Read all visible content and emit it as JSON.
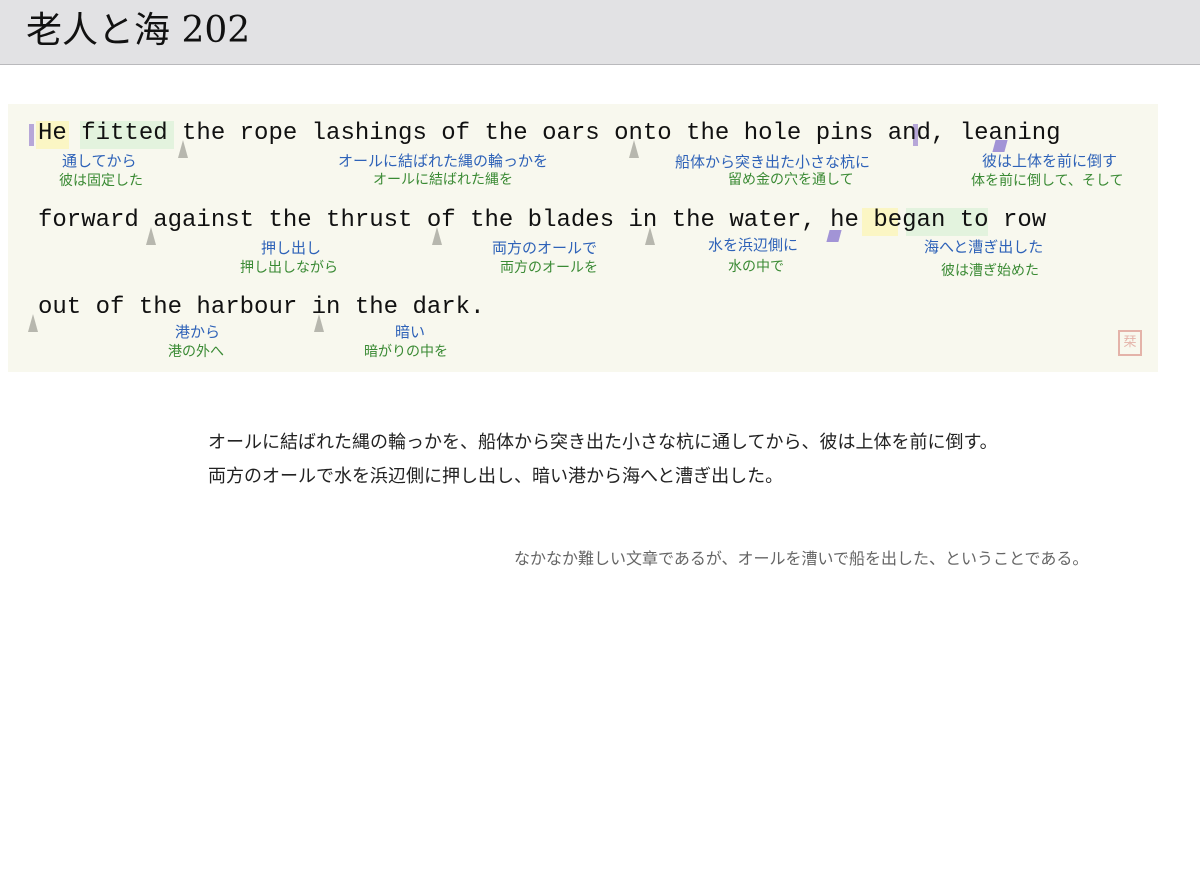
{
  "header": {
    "title": "老人と海 202"
  },
  "sentence": {
    "line1": "He fitted the rope lashings of the oars onto the hole pins and, leaning",
    "line2": "forward against the thrust of the blades in the water, he began to row",
    "line3": "out of the harbour in the dark."
  },
  "glosses": [
    {
      "blue": "通してから",
      "green": "彼は固定した"
    },
    {
      "blue": "オールに結ばれた縄の輪っかを",
      "green": "オールに結ばれた縄を"
    },
    {
      "blue": "船体から突き出た小さな杭に",
      "green": "留め金の穴を通して"
    },
    {
      "blue": "彼は上体を前に倒す",
      "green": "体を前に倒して、そして"
    },
    {
      "blue": "押し出し",
      "green": "押し出しながら"
    },
    {
      "blue": "両方のオールで",
      "green": "両方のオールを"
    },
    {
      "blue": "水を浜辺側に",
      "green": "水の中で"
    },
    {
      "blue": "海へと漕ぎ出した",
      "green": "彼は漕ぎ始めた"
    },
    {
      "blue": "港から",
      "green": "港の外へ"
    },
    {
      "blue": "暗い",
      "green": "暗がりの中を"
    }
  ],
  "stamp_icon": "seal-stamp-icon",
  "translation": {
    "line1": "オールに結ばれた縄の輪っかを、船体から突き出た小さな杭に通してから、彼は上体を前に倒す。",
    "line2": "両方のオールで水を浜辺側に押し出し、暗い港から海へと漕ぎ出した。"
  },
  "note": "なかなか難しい文章であるが、オールを漕いで船を出した、ということである。",
  "colors": {
    "gloss_blue": "#2e62b8",
    "gloss_green": "#3a8a34",
    "highlight_yellow": "#fbf6c4",
    "highlight_green": "#e3f3de",
    "panel_bg": "#f8f8ee"
  }
}
